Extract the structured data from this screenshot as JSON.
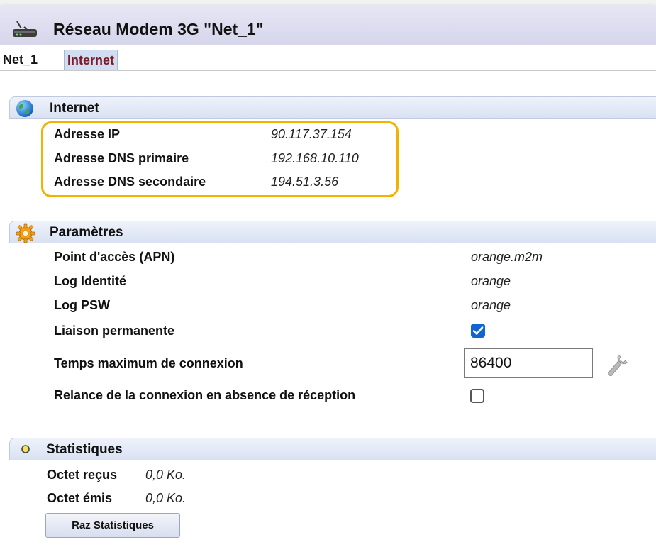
{
  "window": {
    "title": "Réseau Modem 3G \"Net_1\"",
    "icon": "modem-icon"
  },
  "tabs": [
    {
      "label": "Net_1",
      "active": false
    },
    {
      "label": "Internet",
      "active": true
    }
  ],
  "internet": {
    "header": "Internet",
    "icon": "globe-icon",
    "rows": [
      {
        "label": "Adresse IP",
        "value": "90.117.37.154"
      },
      {
        "label": "Adresse DNS primaire",
        "value": "192.168.10.110"
      },
      {
        "label": "Adresse DNS secondaire",
        "value": "194.51.3.56"
      }
    ],
    "highlight_color": "#f2b200"
  },
  "parametres": {
    "header": "Paramètres",
    "icon": "gear-icon",
    "apn": {
      "label": "Point d'accès (APN)",
      "value": "orange.m2m"
    },
    "log_identite": {
      "label": "Log Identité",
      "value": "orange"
    },
    "log_psw": {
      "label": "Log PSW",
      "value": "orange"
    },
    "liaison": {
      "label": "Liaison permanente",
      "checked": true
    },
    "temps": {
      "label": "Temps maximum de connexion",
      "value": "86400",
      "icon": "wrench-icon"
    },
    "relance": {
      "label": "Relance de la connexion en absence de réception",
      "checked": false
    }
  },
  "statistiques": {
    "header": "Statistiques",
    "icon": "status-dot-icon",
    "rows": [
      {
        "label": "Octet reçus",
        "value": "0,0 Ko."
      },
      {
        "label": "Octet émis",
        "value": "0,0 Ko."
      }
    ],
    "reset_button": "Raz Statistiques"
  },
  "colors": {
    "accent": "#0f66d0",
    "header_bg": "#d9e1f2",
    "title_bg": "#d6d6ec",
    "active_tab_text": "#7a1b28"
  }
}
